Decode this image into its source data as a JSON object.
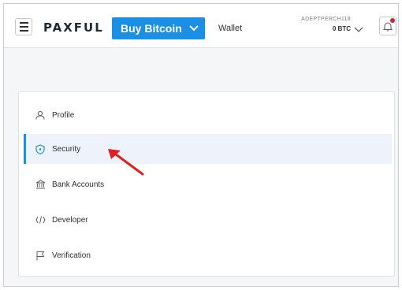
{
  "header": {
    "logo": "PAXFUL",
    "buy_button_label": "Buy Bitcoin",
    "wallet_label": "Wallet",
    "username": "ADEPTPERCH118",
    "balance": "0 BTC"
  },
  "settings_menu": {
    "items": [
      {
        "label": "Profile",
        "icon": "user-icon"
      },
      {
        "label": "Security",
        "icon": "shield-icon",
        "active": true
      },
      {
        "label": "Bank Accounts",
        "icon": "bank-icon"
      },
      {
        "label": "Developer",
        "icon": "code-icon"
      },
      {
        "label": "Verification",
        "icon": "flag-icon"
      }
    ]
  },
  "colors": {
    "accent": "#1a8fe3",
    "annotation_arrow": "#e02020",
    "notification_dot": "#e02020"
  }
}
